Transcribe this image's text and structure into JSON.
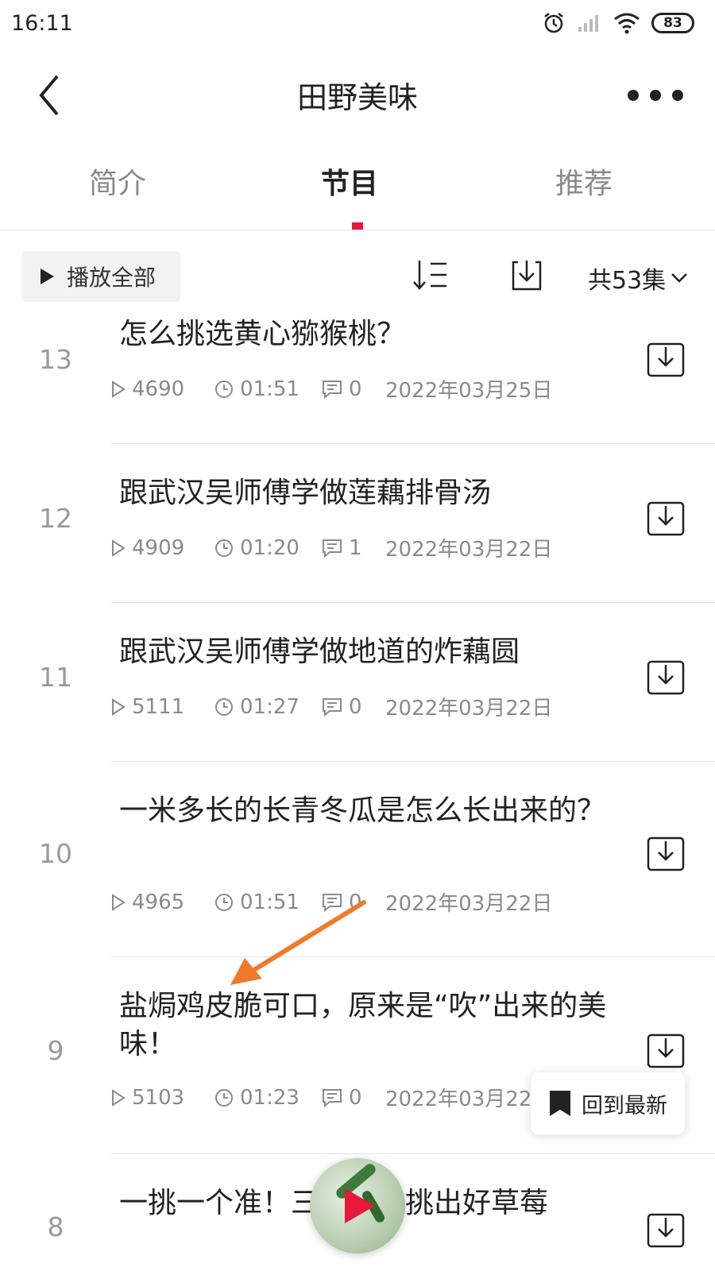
{
  "status_bar": {
    "time": "16:11",
    "battery": "83"
  },
  "header": {
    "title": "田野美味"
  },
  "tabs": [
    {
      "label": "简介",
      "active": false
    },
    {
      "label": "节目",
      "active": true
    },
    {
      "label": "推荐",
      "active": false
    }
  ],
  "toolbar": {
    "play_all_label": "播放全部",
    "episode_count": "共53集"
  },
  "episodes": [
    {
      "num": "13",
      "title": "怎么挑选黄心猕猴桃？",
      "plays": "4690",
      "duration": "01:51",
      "comments": "0",
      "date": "2022年03月25日"
    },
    {
      "num": "12",
      "title": "跟武汉吴师傅学做莲藕排骨汤",
      "plays": "4909",
      "duration": "01:20",
      "comments": "1",
      "date": "2022年03月22日"
    },
    {
      "num": "11",
      "title": "跟武汉吴师傅学做地道的炸藕圆",
      "plays": "5111",
      "duration": "01:27",
      "comments": "0",
      "date": "2022年03月22日"
    },
    {
      "num": "10",
      "title": "一米多长的长青冬瓜是怎么长出来的？",
      "plays": "4965",
      "duration": "01:51",
      "comments": "0",
      "date": "2022年03月22日"
    },
    {
      "num": "9",
      "title": "盐焗鸡皮脆可口，原来是“吹”出来的美味！",
      "plays": "5103",
      "duration": "01:23",
      "comments": "0",
      "date": "2022年03月22日"
    },
    {
      "num": "8",
      "title": "一挑一个准！三招教你挑出好草莓"
    }
  ],
  "back_to_latest_label": "回到最新",
  "colors": {
    "accent": "#e8183b",
    "annotation_arrow": "#f07a2a"
  }
}
